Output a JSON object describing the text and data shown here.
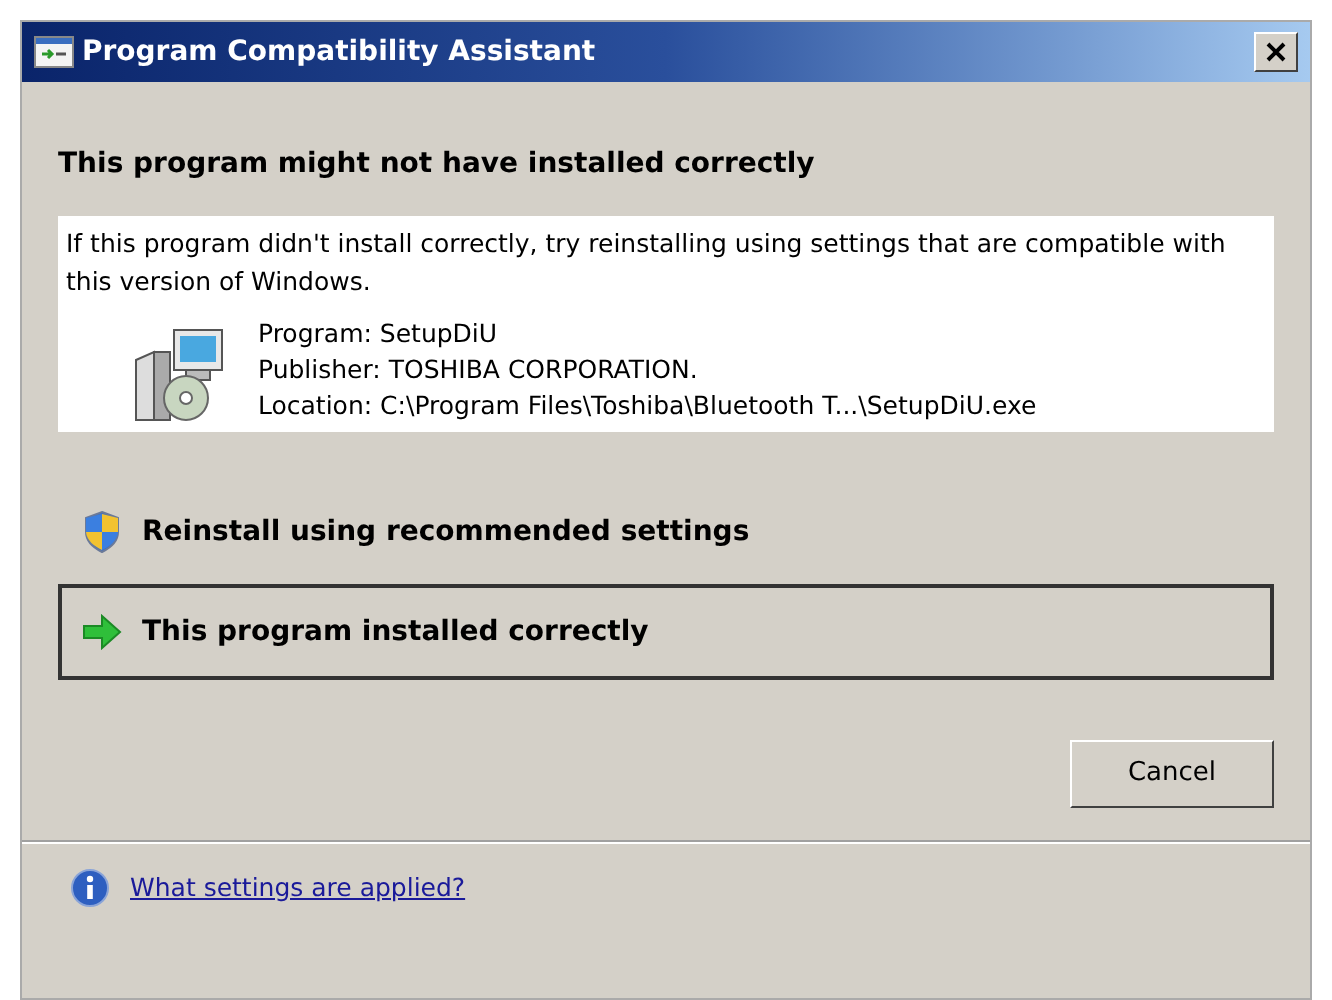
{
  "window": {
    "title": "Program Compatibility Assistant"
  },
  "heading": "This program might not have installed correctly",
  "message": "If this program didn't install correctly, try reinstalling using settings that are compatible with this version of Windows.",
  "program_info": [
    "Program: SetupDiU",
    "Publisher: TOSHIBA CORPORATION.",
    "Location: C:\\Program Files\\Toshiba\\Bluetooth T...\\SetupDiU.exe"
  ],
  "options": [
    {
      "kind": "shield",
      "label": "Reinstall using recommended settings",
      "selected": false
    },
    {
      "kind": "arrow",
      "label": "This program installed correctly",
      "selected": true
    }
  ],
  "buttons": [
    "Cancel"
  ],
  "link": "What settings are applied?"
}
